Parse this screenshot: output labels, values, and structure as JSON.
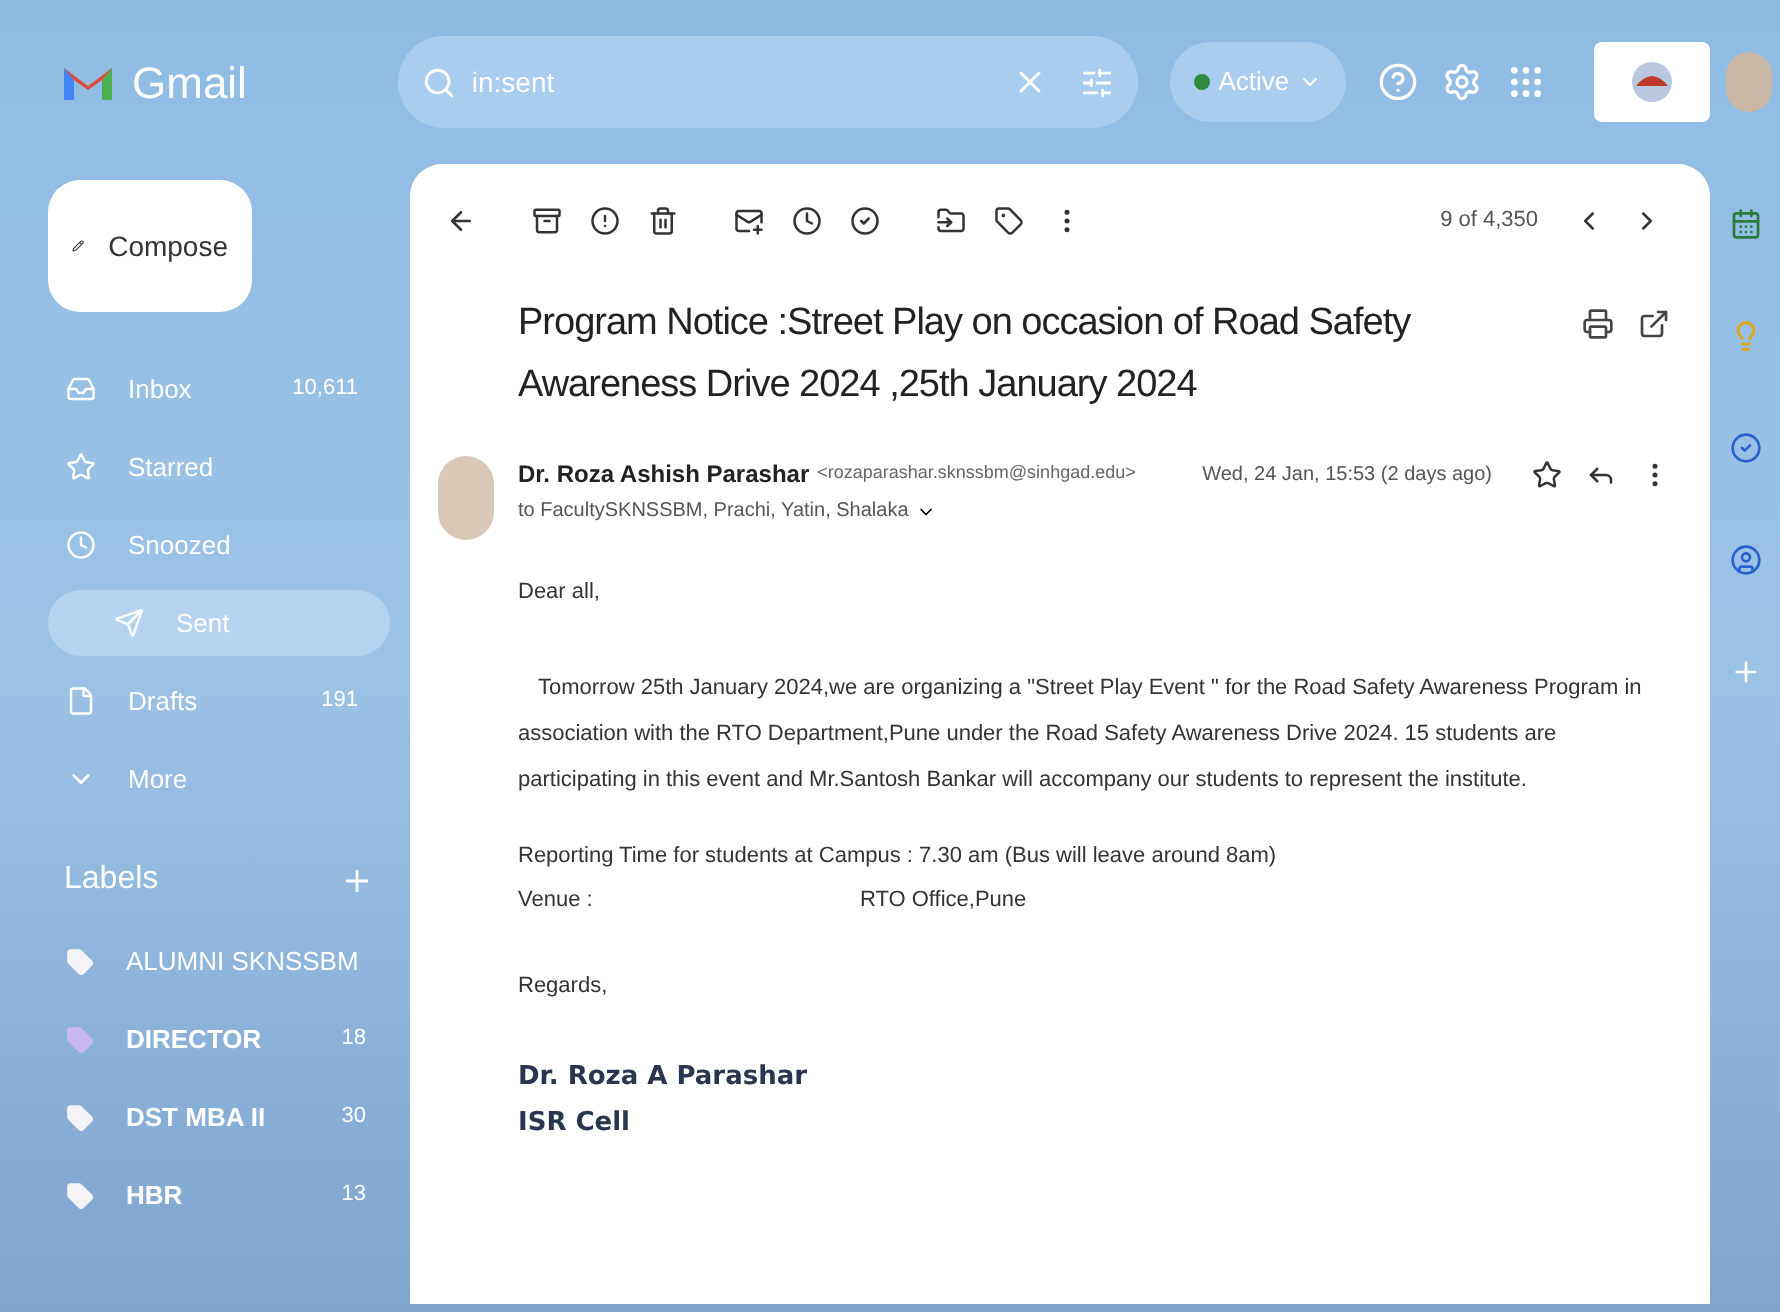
{
  "app": {
    "name": "Gmail"
  },
  "search": {
    "value": "in:sent"
  },
  "status": {
    "label": "Active",
    "active": true
  },
  "compose": {
    "label": "Compose"
  },
  "nav": [
    {
      "kind": "inbox",
      "label": "Inbox",
      "count": "10,611",
      "selected": false
    },
    {
      "kind": "starred",
      "label": "Starred",
      "selected": false
    },
    {
      "kind": "snoozed",
      "label": "Snoozed",
      "selected": false
    },
    {
      "kind": "sent",
      "label": "Sent",
      "selected": true
    },
    {
      "kind": "drafts",
      "label": "Drafts",
      "count": "191",
      "selected": false
    },
    {
      "kind": "more",
      "label": "More",
      "selected": false
    }
  ],
  "labels": {
    "title": "Labels",
    "items": [
      {
        "label": "ALUMNI SKNSSBM",
        "color": "#f4f4f8",
        "bold": false
      },
      {
        "label": "DIRECTOR",
        "count": "18",
        "color": "#c9b8f0",
        "bold": true
      },
      {
        "label": "DST MBA II",
        "count": "30",
        "color": "#f4f4f8",
        "bold": true
      },
      {
        "label": "HBR",
        "count": "13",
        "color": "#f4f4f8",
        "bold": true
      }
    ]
  },
  "toolbar": {
    "position": "9 of 4,350"
  },
  "email": {
    "subject": "Program Notice :Street Play on occasion of Road Safety Awareness Drive 2024 ,25th January 2024",
    "sender": "Dr. Roza Ashish Parashar",
    "address": "<rozaparashar.sknssbm@sinhgad.edu>",
    "date": "Wed, 24 Jan, 15:53 (2 days ago)",
    "to": "to FacultySKNSSBM, Prachi, Yatin, Shalaka",
    "greeting": "Dear all,",
    "paragraph": "Tomorrow 25th January 2024,we are organizing a \"Street Play Event \" for the Road Safety Awareness Program in association with the RTO Department,Pune under the Road Safety Awareness Drive 2024. 15 students are participating in this event and Mr.Santosh Bankar will accompany our students to represent the institute.",
    "reporting": "Reporting Time for students at Campus : 7.30 am (Bus will leave around 8am)",
    "venue_label": "Venue :",
    "venue_value": "RTO Office,Pune",
    "closing": "Regards,",
    "signature": [
      "Dr. Roza A Parashar",
      "ISR Cell"
    ]
  }
}
